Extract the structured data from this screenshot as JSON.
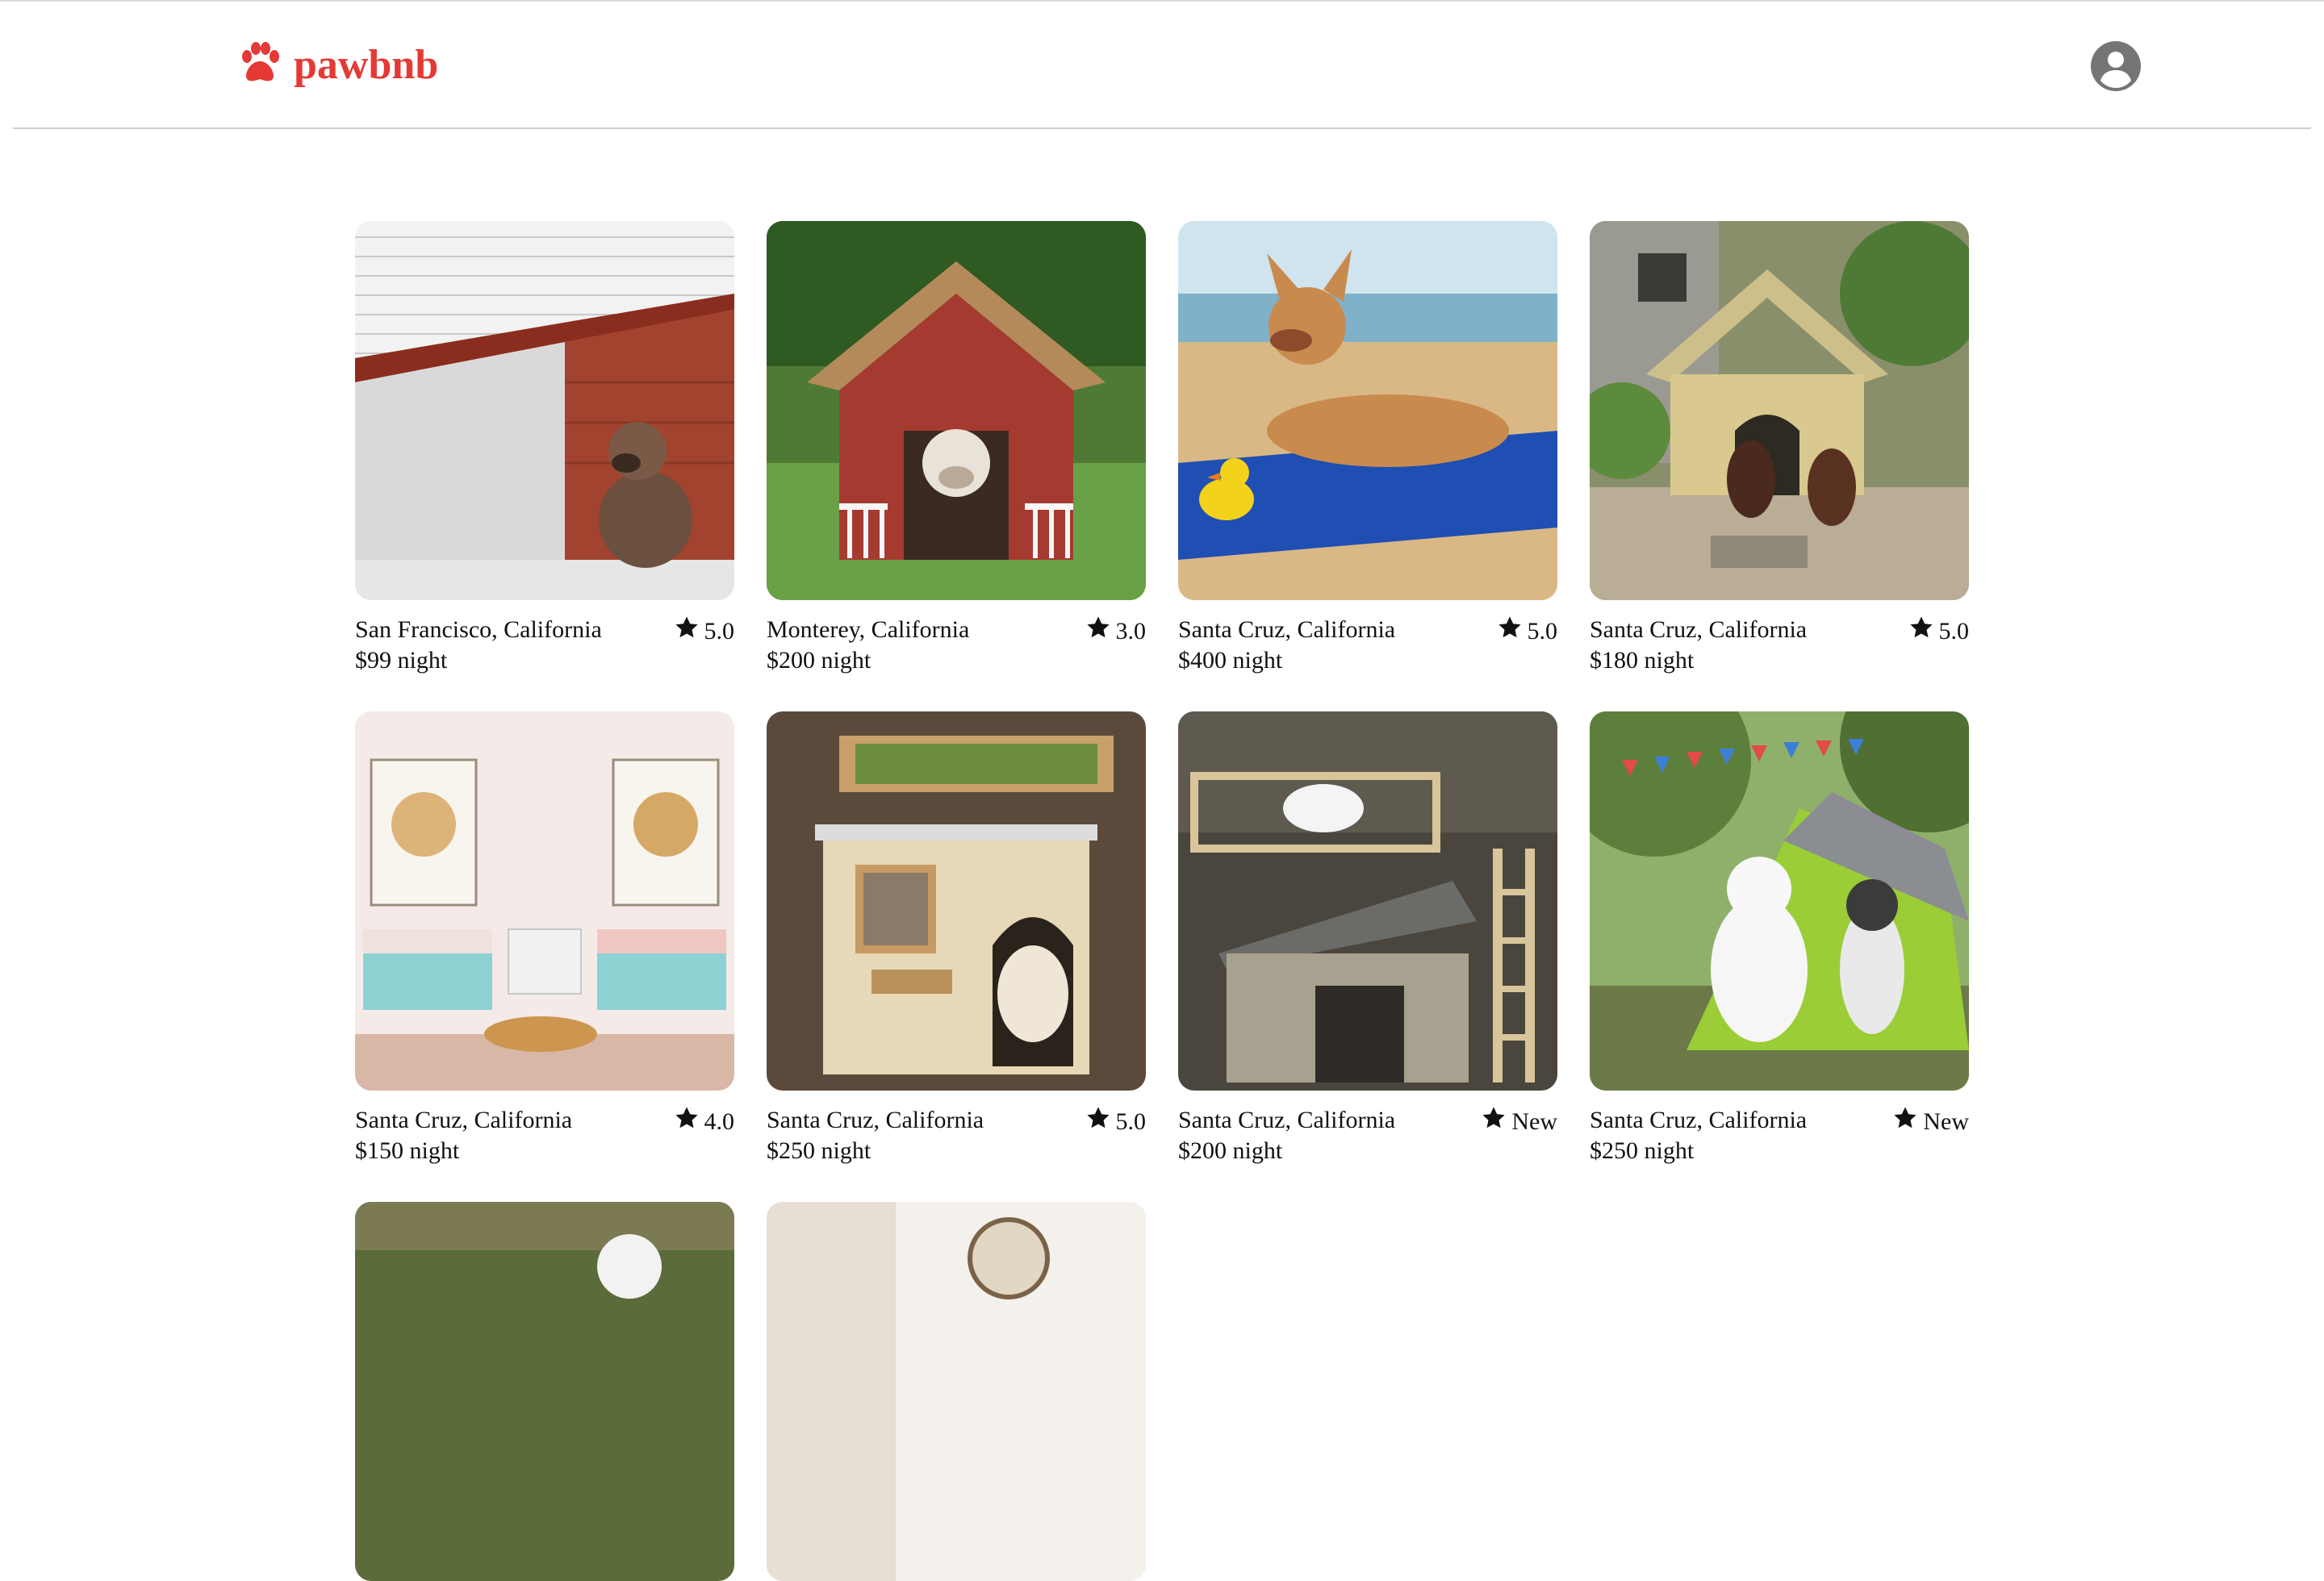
{
  "app": {
    "brand": "pawbnb",
    "brand_color": "#e53935"
  },
  "header": {
    "logo_icon": "paw-icon",
    "profile_icon": "user-avatar-icon"
  },
  "listings": [
    {
      "location": "San Francisco, California",
      "price": "$99 night",
      "rating": "5.0",
      "scene": "modern-kennel-bulldog"
    },
    {
      "location": "Monterey, California",
      "price": "$200 night",
      "rating": "3.0",
      "scene": "red-doghouse-bulldog"
    },
    {
      "location": "Santa Cruz, California",
      "price": "$400 night",
      "rating": "5.0",
      "scene": "beach-towel-chihuahua"
    },
    {
      "location": "Santa Cruz, California",
      "price": "$180 night",
      "rating": "5.0",
      "scene": "garden-kennel-spaniels"
    },
    {
      "location": "Santa Cruz, California",
      "price": "$150 night",
      "rating": "4.0",
      "scene": "bedroom-golden-retriever"
    },
    {
      "location": "Santa Cruz, California",
      "price": "$250 night",
      "rating": "5.0",
      "scene": "rooftop-garden-doodle"
    },
    {
      "location": "Santa Cruz, California",
      "price": "$200 night",
      "rating": "New",
      "scene": "deck-doghouse-pitbull"
    },
    {
      "location": "Santa Cruz, California",
      "price": "$250 night",
      "rating": "New",
      "scene": "tent-huskies"
    },
    {
      "location": "",
      "price": "",
      "rating": "",
      "scene": "hillside-dog"
    },
    {
      "location": "",
      "price": "",
      "rating": "",
      "scene": "clock-room"
    }
  ],
  "star_icon": "star-icon"
}
